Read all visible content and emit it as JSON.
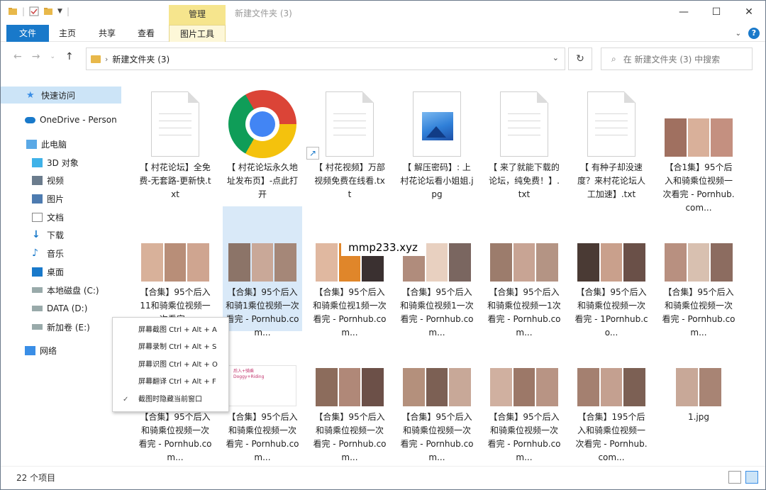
{
  "window": {
    "title": "新建文件夹 (3)",
    "contextual_tab": "管理"
  },
  "ribbon": {
    "tabs": [
      "文件",
      "主页",
      "共享",
      "查看",
      "图片工具"
    ],
    "help": "?"
  },
  "address": {
    "path": "新建文件夹 (3)",
    "search_placeholder": "在 新建文件夹 (3) 中搜索"
  },
  "sidebar": {
    "items": [
      {
        "label": "快速访问",
        "icon": "star-icon"
      },
      {
        "label": "OneDrive - Person",
        "icon": "cloud-icon"
      },
      {
        "label": "此电脑",
        "icon": "computer-icon"
      },
      {
        "label": "3D 对象",
        "icon": "cube-icon"
      },
      {
        "label": "视频",
        "icon": "video-icon"
      },
      {
        "label": "图片",
        "icon": "picture-icon"
      },
      {
        "label": "文档",
        "icon": "document-icon"
      },
      {
        "label": "下载",
        "icon": "download-icon"
      },
      {
        "label": "音乐",
        "icon": "music-icon"
      },
      {
        "label": "桌面",
        "icon": "desktop-icon"
      },
      {
        "label": "本地磁盘 (C:)",
        "icon": "drive-icon"
      },
      {
        "label": "DATA (D:)",
        "icon": "drive-icon"
      },
      {
        "label": "新加卷 (E:)",
        "icon": "drive-icon"
      },
      {
        "label": "网络",
        "icon": "network-icon"
      }
    ]
  },
  "context_menu": {
    "items": [
      "屏幕截图 Ctrl + Alt + A",
      "屏幕录制 Ctrl + Alt + S",
      "屏幕识图 Ctrl + Alt + O",
      "屏幕翻译 Ctrl + Alt + F",
      "截图时隐藏当前窗口"
    ],
    "check": "✓"
  },
  "files": [
    {
      "name": "【 村花论坛】全免费-无套路-更新快.txt",
      "kind": "txt"
    },
    {
      "name": "【 村花论坛永久地址发布页】-点此打开",
      "kind": "chrome"
    },
    {
      "name": "【 村花视频】万部视频免费在线看.txt",
      "kind": "txt"
    },
    {
      "name": "【 解压密码】: 上村花论坛看小姐姐.jpg",
      "kind": "image"
    },
    {
      "name": "【 来了就能下载的论坛，纯免费！】.txt",
      "kind": "txt"
    },
    {
      "name": "【 有种子却没速度？来村花论坛人工加速】.txt",
      "kind": "txt"
    },
    {
      "name": "【合1集】95个后入和骑乘位视频一次看完 - Pornhub.com...",
      "kind": "video"
    },
    {
      "name": "【合集】95个后入11和骑乘位视频一次看完 -",
      "kind": "video"
    },
    {
      "name": "【合集】95个后入和骑1乘位视频一次看完 - Pornhub.com...",
      "kind": "video"
    },
    {
      "name": "【合集】95个后入和骑乘位视1频一次看完 - Pornhub.com...",
      "kind": "video"
    },
    {
      "name": "【合集】95个后入和骑乘位视频1一次看完 - Pornhub.com...",
      "kind": "video"
    },
    {
      "name": "【合集】95个后入和骑乘位视频一1次看完 - Pornhub.com...",
      "kind": "video"
    },
    {
      "name": "【合集】95个后入和骑乘位视频一次看完 - 1Pornhub.co...",
      "kind": "video"
    },
    {
      "name": "【合集】95个后入和骑乘位视频一次看完 - Pornhub.com...",
      "kind": "video"
    },
    {
      "name": "【合集】95个后入和骑乘位视频一次看完 - Pornhub.com...",
      "kind": "video"
    },
    {
      "name": "【合集】95个后入和骑乘位视频一次看完 - Pornhub.com...",
      "kind": "card"
    },
    {
      "name": "【合集】95个后入和骑乘位视频一次看完 - Pornhub.com...",
      "kind": "video"
    },
    {
      "name": "【合集】95个后入和骑乘位视频一次看完 - Pornhub.com...",
      "kind": "video"
    },
    {
      "name": "【合集】95个后入和骑乘位视频一次看完 - Pornhub.com...",
      "kind": "video"
    },
    {
      "name": "【合集】195个后入和骑乘位视频一次看完 - Pornhub.com...",
      "kind": "video"
    },
    {
      "name": "1.jpg",
      "kind": "video"
    }
  ],
  "card_thumb_text": "后入+骑乘\nDoggy+Riding",
  "watermark": "mmp233.xyz",
  "status": {
    "count": "22 个项目"
  },
  "colors": {
    "accent": "#1979ca",
    "contextual_tab": "#f6e58d",
    "selection": "#cce4f7"
  }
}
